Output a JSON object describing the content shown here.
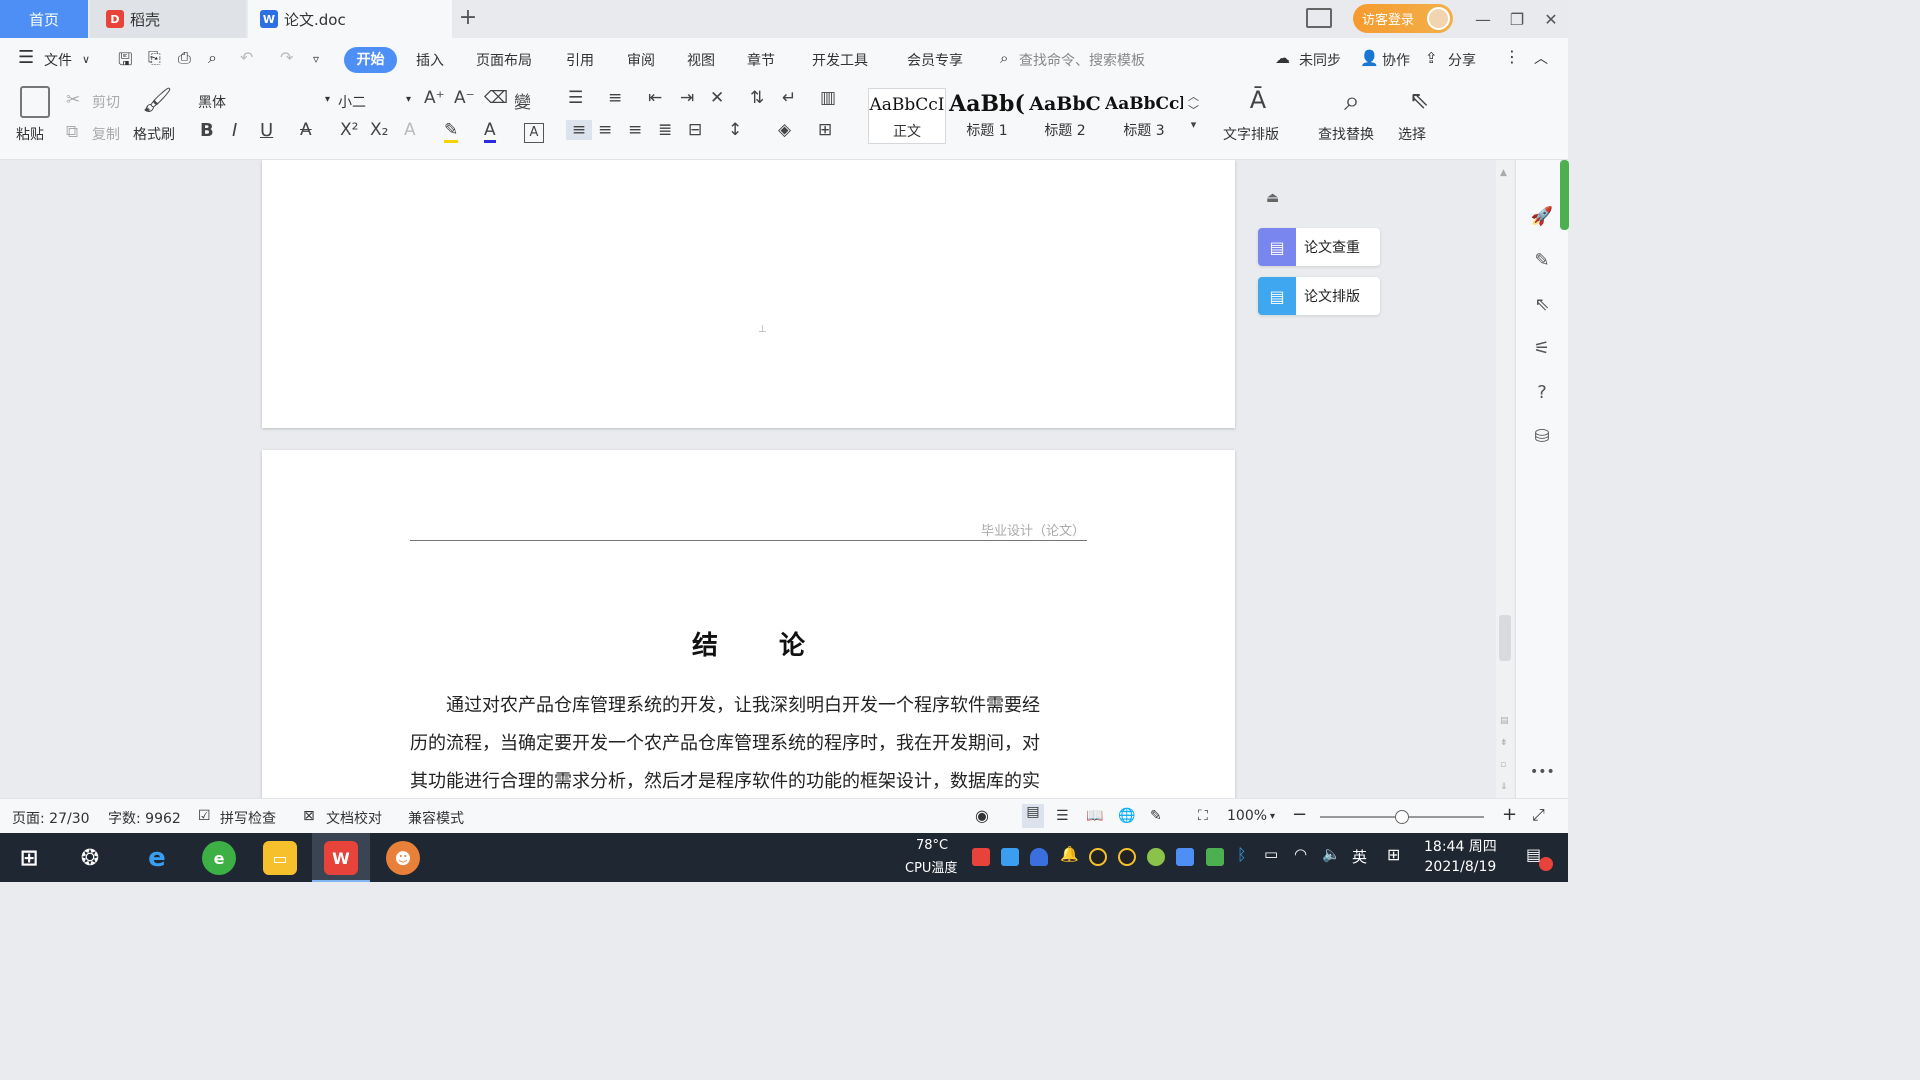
{
  "tabs": {
    "home": "首页",
    "daoke": "稻壳",
    "doc": "论文.doc",
    "new_tab": "+"
  },
  "titlebar": {
    "login": "访客登录"
  },
  "menubar": {
    "file": "文件",
    "items": [
      "开始",
      "插入",
      "页面布局",
      "引用",
      "审阅",
      "视图",
      "章节",
      "开发工具",
      "会员专享"
    ],
    "search": "查找命令、搜索模板",
    "sync": "未同步",
    "collab": "协作",
    "share": "分享"
  },
  "ribbon": {
    "paste": "粘贴",
    "cut": "剪切",
    "copy": "复制",
    "format_painter": "格式刷",
    "font": "黑体",
    "size": "小二",
    "styles": [
      {
        "sample": "AaBbCcI",
        "label": "正文"
      },
      {
        "sample": "AaBb(",
        "label": "标题 1"
      },
      {
        "sample": "AaBbC",
        "label": "标题 2"
      },
      {
        "sample": "AaBbCcl",
        "label": "标题 3"
      }
    ],
    "text_layout": "文字排版",
    "find_replace": "查找替换",
    "select": "选择"
  },
  "document": {
    "header": "毕业设计（论文）",
    "title": "结 论",
    "paragraphs": [
      "通过对农产品仓库管理系统的开发，让我深刻明白开发一个程序软件需要经",
      "历的流程，当确定要开发一个农产品仓库管理系统的程序时，我在开发期间，对",
      "其功能进行合理的需求分析，然后才是程序软件的功能的框架设计，数据库的实"
    ]
  },
  "sidepanel": {
    "check": "论文查重",
    "layout": "论文排版"
  },
  "statusbar": {
    "page": "页面: 27/30",
    "words": "字数: 9962",
    "spell": "拼写检查",
    "proof": "文档校对",
    "compat": "兼容模式",
    "zoom": "100%",
    "zoom_level": 0.5
  },
  "taskbar": {
    "cpu_temp": "78°C",
    "cpu_label": "CPU温度",
    "ime": "英",
    "time": "18:44 周四",
    "date": "2021/8/19"
  },
  "colors": {
    "accent": "#4d8ff5",
    "login": "#f59b2f",
    "taskbar": "#1f2732"
  }
}
